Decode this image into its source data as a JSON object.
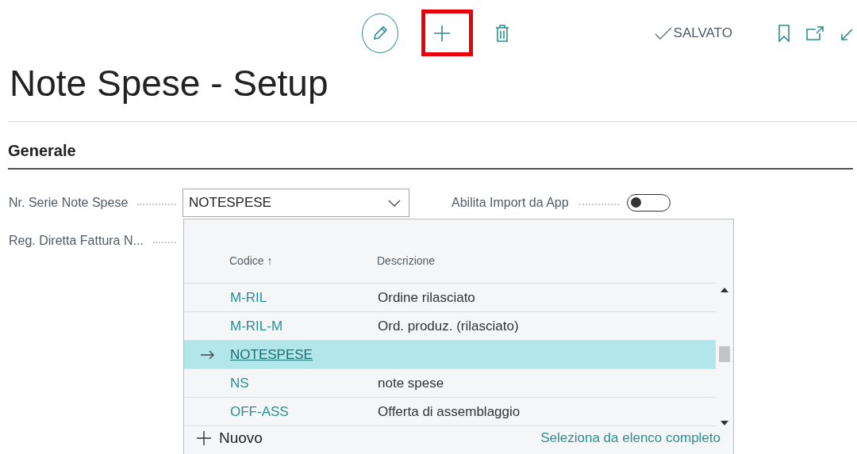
{
  "toolbar": {
    "status": "SALVATO"
  },
  "title": "Note Spese - Setup",
  "section": {
    "title": "Generale"
  },
  "fields": [
    {
      "label": "Nr. Serie Note Spese",
      "value": "NOTESPESE"
    },
    {
      "label": "Reg. Diretta Fattura N..."
    }
  ],
  "toggle": {
    "label": "Abilita Import da App",
    "on": false
  },
  "lookup": {
    "columns": [
      "Codice ↑",
      "Descrizione"
    ],
    "rows": [
      {
        "code": "M-RIL",
        "description": "Ordine rilasciato",
        "selected": false
      },
      {
        "code": "M-RIL-M",
        "description": "Ord. produz. (rilasciato)",
        "selected": false
      },
      {
        "code": "NOTESPESE",
        "selected": true
      },
      {
        "code": "NS",
        "description": "note spese",
        "selected": false
      },
      {
        "code": "OFF-ASS",
        "description": "Offerta di assemblaggio",
        "selected": false
      }
    ],
    "new_label": "Nuovo",
    "full_list_link": "Seleziona da elenco completo"
  }
}
